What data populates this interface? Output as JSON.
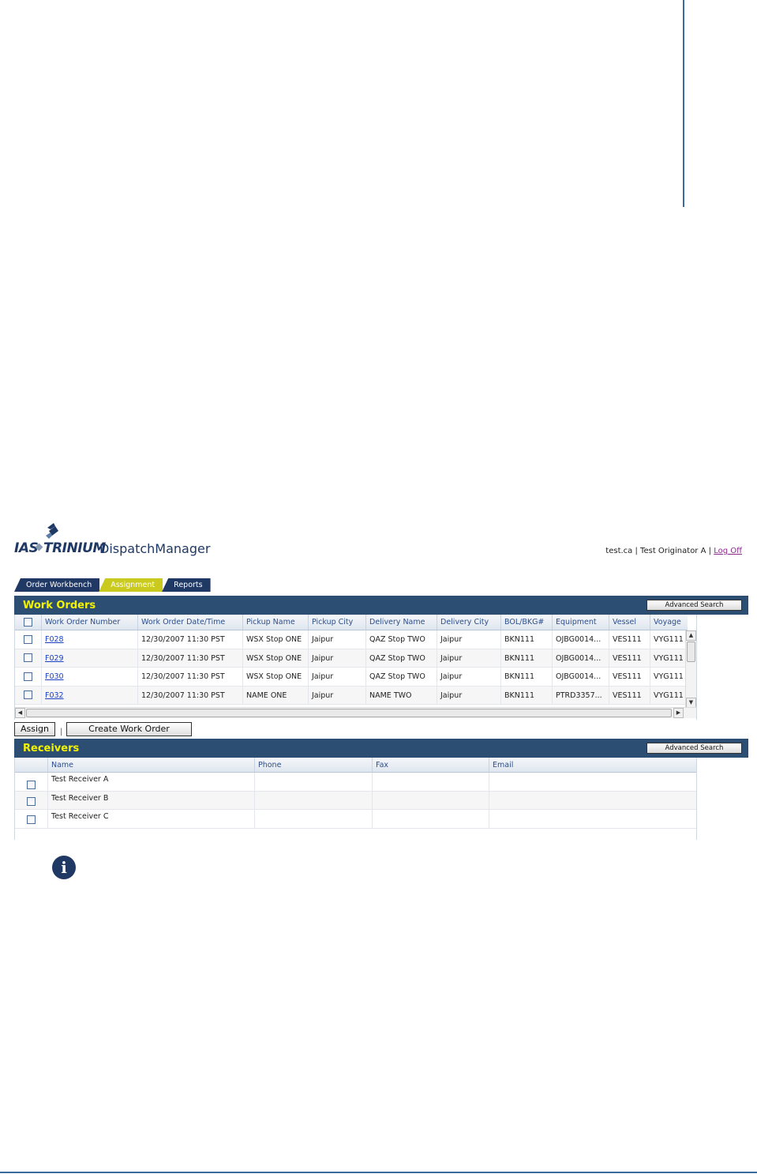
{
  "brand": {
    "company_a": "IAS",
    "company_b": "TRINIUM",
    "product": "DispatchManager"
  },
  "user_bar": {
    "user": "test.ca",
    "separator1": " | ",
    "role": "Test Originator A",
    "separator2": " | ",
    "logoff": "Log Off"
  },
  "tabs": [
    {
      "label": "Order Workbench",
      "active": false
    },
    {
      "label": "Assignment",
      "active": true
    },
    {
      "label": "Reports",
      "active": false
    }
  ],
  "work_orders": {
    "title": "Work Orders",
    "advanced_search": "Advanced Search",
    "columns": [
      "Work Order Number",
      "Work Order Date/Time",
      "Pickup Name",
      "Pickup City",
      "Delivery Name",
      "Delivery City",
      "BOL/BKG#",
      "Equipment",
      "Vessel",
      "Voyage"
    ],
    "rows": [
      [
        "F028",
        "12/30/2007 11:30 PST",
        "WSX Stop ONE",
        "Jaipur",
        "QAZ Stop TWO",
        "Jaipur",
        "BKN111",
        "OJBG0014...",
        "VES111",
        "VYG111"
      ],
      [
        "F029",
        "12/30/2007 11:30 PST",
        "WSX Stop ONE",
        "Jaipur",
        "QAZ Stop TWO",
        "Jaipur",
        "BKN111",
        "OJBG0014...",
        "VES111",
        "VYG111"
      ],
      [
        "F030",
        "12/30/2007 11:30 PST",
        "WSX Stop ONE",
        "Jaipur",
        "QAZ Stop TWO",
        "Jaipur",
        "BKN111",
        "OJBG0014...",
        "VES111",
        "VYG111"
      ],
      [
        "F032",
        "12/30/2007 11:30 PST",
        "NAME ONE",
        "Jaipur",
        "NAME TWO",
        "Jaipur",
        "BKN111",
        "PTRD3357...",
        "VES111",
        "VYG111"
      ]
    ]
  },
  "actions": {
    "assign": "Assign",
    "separator": "|",
    "create": "Create Work Order"
  },
  "receivers": {
    "title": "Receivers",
    "advanced_search": "Advanced Search",
    "columns": [
      "Name",
      "Phone",
      "Fax",
      "Email"
    ],
    "rows": [
      [
        "Test Receiver A",
        "",
        "",
        ""
      ],
      [
        "Test Receiver B",
        "",
        "",
        ""
      ],
      [
        "Test Receiver C",
        "",
        "",
        ""
      ]
    ]
  },
  "icons": {
    "info": "info-icon",
    "info_glyph": "i"
  },
  "colors": {
    "navy": "#1f3864",
    "section_bar": "#2c4e73",
    "section_title": "#f3f300",
    "active_tab": "#c9c91e",
    "link": "#1a3fc7"
  }
}
